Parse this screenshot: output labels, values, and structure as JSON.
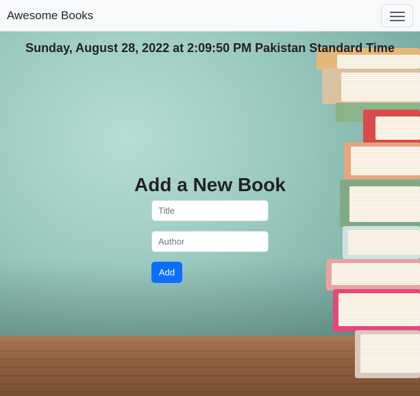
{
  "navbar": {
    "brand": "Awesome Books",
    "menu_icon": "hamburger-menu-icon"
  },
  "datetime": "Sunday, August 28, 2022 at 2:09:50 PM Pakistan Standard Time",
  "form": {
    "title": "Add a New Book",
    "title_placeholder": "Title",
    "author_placeholder": "Author",
    "add_label": "Add"
  },
  "colors": {
    "navbar_bg": "#f8f9fa",
    "button_primary": "#0d6efd"
  }
}
